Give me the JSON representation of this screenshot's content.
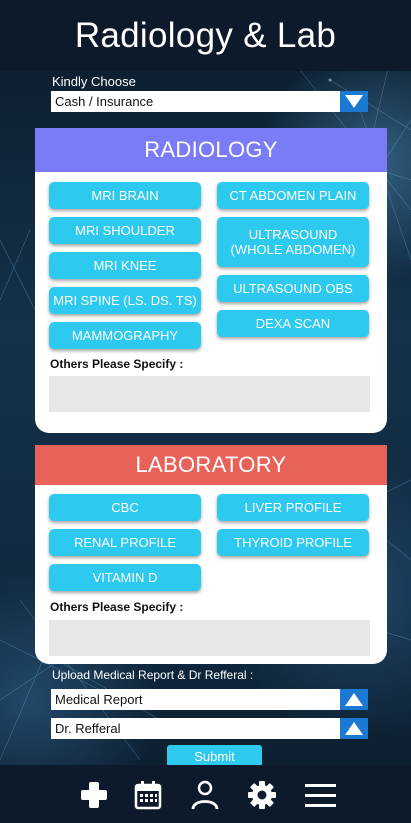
{
  "header": {
    "title": "Radiology & Lab"
  },
  "payment": {
    "label": "Kindly Choose",
    "selected": "Cash / Insurance"
  },
  "radiology": {
    "title": "RADIOLOGY",
    "color": "#7a7cf7",
    "left_items": [
      "MRI BRAIN",
      "MRI SHOULDER",
      "MRI KNEE",
      "MRI SPINE (LS. DS. TS)",
      "MAMMOGRAPHY"
    ],
    "right_items": [
      "CT ABDOMEN PLAIN",
      "ULTRASOUND (WHOLE ABDOMEN)",
      "ULTRASOUND OBS",
      "DEXA SCAN"
    ],
    "others_label": "Others Please Specify :"
  },
  "laboratory": {
    "title": "LABORATORY",
    "color": "#e9625a",
    "left_items": [
      "CBC",
      "RENAL PROFILE",
      "VITAMIN D"
    ],
    "right_items": [
      "LIVER PROFILE",
      "THYROID PROFILE"
    ],
    "others_label": "Others Please Specify :"
  },
  "upload": {
    "label": "Upload Medical Report & Dr Refferal :",
    "medical_report": "Medical Report",
    "dr_referral": "Dr. Refferal"
  },
  "submit_label": "Submit",
  "nav": {
    "icons": [
      "plus-icon",
      "calendar-icon",
      "user-icon",
      "gear-icon",
      "menu-icon"
    ]
  },
  "colors": {
    "accent": "#2dc9ef",
    "dropdown": "#1c79d2",
    "header": "#0c1a2c"
  }
}
